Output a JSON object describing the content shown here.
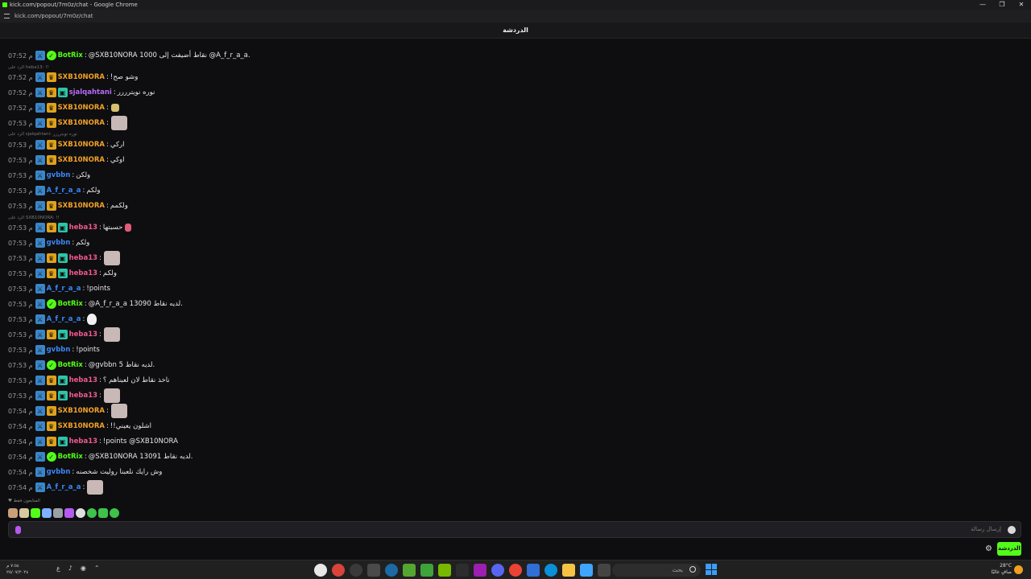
{
  "window": {
    "title": "kick.com/popout/7m0z/chat - Google Chrome",
    "url": "kick.com/popout/7m0z/chat",
    "controls": [
      "—",
      "❐",
      "✕"
    ]
  },
  "header": {
    "title": "الدردشة"
  },
  "messages": [
    {
      "time": "07:52 م",
      "badges": [
        "mod",
        "verified"
      ],
      "user": "BotRix",
      "color": "green",
      "text": "@SXB10NORA 1000 نقاط أضيفت إلى @A_f_r_a_a.",
      "emote": ""
    },
    {
      "time": "07:52 م",
      "badges": [
        "mod",
        "sub"
      ],
      "user": "SXB10NORA",
      "color": "orange",
      "text": "!وشو صح",
      "emote": ""
    },
    {
      "time": "07:52 م",
      "badges": [
        "mod",
        "sub",
        "gift"
      ],
      "user": "sjalqahtani",
      "color": "purple",
      "text": "نوره نويترررر",
      "emote": ""
    },
    {
      "time": "07:52 م",
      "badges": [
        "mod",
        "sub"
      ],
      "user": "SXB10NORA",
      "color": "orange",
      "text": "",
      "emote": "small"
    },
    {
      "time": "07:53 م",
      "badges": [
        "mod",
        "sub"
      ],
      "user": "SXB10NORA",
      "color": "orange",
      "text": "",
      "emote": "face"
    },
    {
      "time": "07:53 م",
      "badges": [
        "mod",
        "sub"
      ],
      "user": "SXB10NORA",
      "color": "orange",
      "text": "اركي",
      "emote": ""
    },
    {
      "time": "07:53 م",
      "badges": [
        "mod",
        "sub"
      ],
      "user": "SXB10NORA",
      "color": "orange",
      "text": "اوكي",
      "emote": ""
    },
    {
      "time": "07:53 م",
      "badges": [
        "mod"
      ],
      "user": "gvbbn",
      "color": "blue",
      "text": "ولكن",
      "emote": ""
    },
    {
      "time": "07:53 م",
      "badges": [
        "mod"
      ],
      "user": "A_f_r_a_a",
      "color": "blue",
      "text": "ولكم",
      "emote": ""
    },
    {
      "time": "07:53 م",
      "badges": [
        "mod",
        "sub"
      ],
      "user": "SXB10NORA",
      "color": "orange",
      "text": "ولكمم",
      "emote": ""
    },
    {
      "time": "07:53 م",
      "badges": [
        "mod",
        "sub",
        "gift"
      ],
      "user": "heba13",
      "color": "pink",
      "text": "حسبتها",
      "emote": "red"
    },
    {
      "time": "07:53 م",
      "badges": [
        "mod"
      ],
      "user": "gvbbn",
      "color": "blue",
      "text": "ولكم",
      "emote": ""
    },
    {
      "time": "07:53 م",
      "badges": [
        "mod",
        "sub",
        "gift"
      ],
      "user": "heba13",
      "color": "pink",
      "text": "",
      "emote": "face"
    },
    {
      "time": "07:53 م",
      "badges": [
        "mod",
        "sub",
        "gift"
      ],
      "user": "heba13",
      "color": "pink",
      "text": "ولكم",
      "emote": ""
    },
    {
      "time": "07:53 م",
      "badges": [
        "mod"
      ],
      "user": "A_f_r_a_a",
      "color": "blue",
      "text": "!points",
      "emote": ""
    },
    {
      "time": "07:53 م",
      "badges": [
        "mod",
        "verified"
      ],
      "user": "BotRix",
      "color": "green",
      "text": "@A_f_r_a_a 13090 لديه نقاط.",
      "emote": ""
    },
    {
      "time": "07:53 م",
      "badges": [
        "mod"
      ],
      "user": "A_f_r_a_a",
      "color": "blue",
      "text": "",
      "emote": "ghost"
    },
    {
      "time": "07:53 م",
      "badges": [
        "mod",
        "sub",
        "gift"
      ],
      "user": "heba13",
      "color": "pink",
      "text": "",
      "emote": "face"
    },
    {
      "time": "07:53 م",
      "badges": [
        "mod"
      ],
      "user": "gvbbn",
      "color": "blue",
      "text": "!points",
      "emote": ""
    },
    {
      "time": "07:53 م",
      "badges": [
        "mod",
        "verified"
      ],
      "user": "BotRix",
      "color": "green",
      "text": "@gvbbn 5 لديه نقاط.",
      "emote": ""
    },
    {
      "time": "07:53 م",
      "badges": [
        "mod",
        "sub",
        "gift"
      ],
      "user": "heba13",
      "color": "pink",
      "text": "ناخذ نقاط لان لعبناهم ؟",
      "emote": ""
    },
    {
      "time": "07:53 م",
      "badges": [
        "mod",
        "sub",
        "gift"
      ],
      "user": "heba13",
      "color": "pink",
      "text": "",
      "emote": "face"
    },
    {
      "time": "07:54 م",
      "badges": [
        "mod",
        "sub"
      ],
      "user": "SXB10NORA",
      "color": "orange",
      "text": "",
      "emote": "face"
    },
    {
      "time": "07:54 م",
      "badges": [
        "mod",
        "sub"
      ],
      "user": "SXB10NORA",
      "color": "orange",
      "text": "!!اشلون يعيني",
      "emote": ""
    },
    {
      "time": "07:54 م",
      "badges": [
        "mod",
        "sub",
        "gift"
      ],
      "user": "heba13",
      "color": "pink",
      "text": "!points @SXB10NORA",
      "emote": ""
    },
    {
      "time": "07:54 م",
      "badges": [
        "mod",
        "verified"
      ],
      "user": "BotRix",
      "color": "green",
      "text": "@SXB10NORA 13091 لديه نقاط.",
      "emote": ""
    },
    {
      "time": "07:54 م",
      "badges": [
        "mod"
      ],
      "user": "gvbbn",
      "color": "blue",
      "text": "وش رايك نلعبنا روليت شخصنه",
      "emote": ""
    },
    {
      "time": "07:54 م",
      "badges": [
        "mod"
      ],
      "user": "A_f_r_a_a",
      "color": "blue",
      "text": "",
      "emote": "face"
    }
  ],
  "replies": [
    {
      "text": "الرد على heba13: !!"
    },
    {
      "text": "الرد على sjalqahtani: نوره نويترررر"
    },
    {
      "text": "الرد على SXB10NORA: !!"
    }
  ],
  "pinned_note": "المتابعون فقط",
  "input": {
    "placeholder": "إرسال رسالة"
  },
  "chat_button": "الدردشة",
  "taskbar": {
    "clock_time": "٧:٥٤ م",
    "clock_date": "٢٥/٠٧/٢٠٢٤",
    "search_placeholder": "بحث",
    "weather_temp": "28°C",
    "weather_desc": "صافٍ غالبًا"
  },
  "colors": {
    "orange": "#f3a128",
    "green": "#53fc18",
    "purple": "#b46cf5",
    "blue": "#3b86f5",
    "pink": "#ef5a8d",
    "accent": "#53fc18",
    "background": "#0e0e10"
  }
}
